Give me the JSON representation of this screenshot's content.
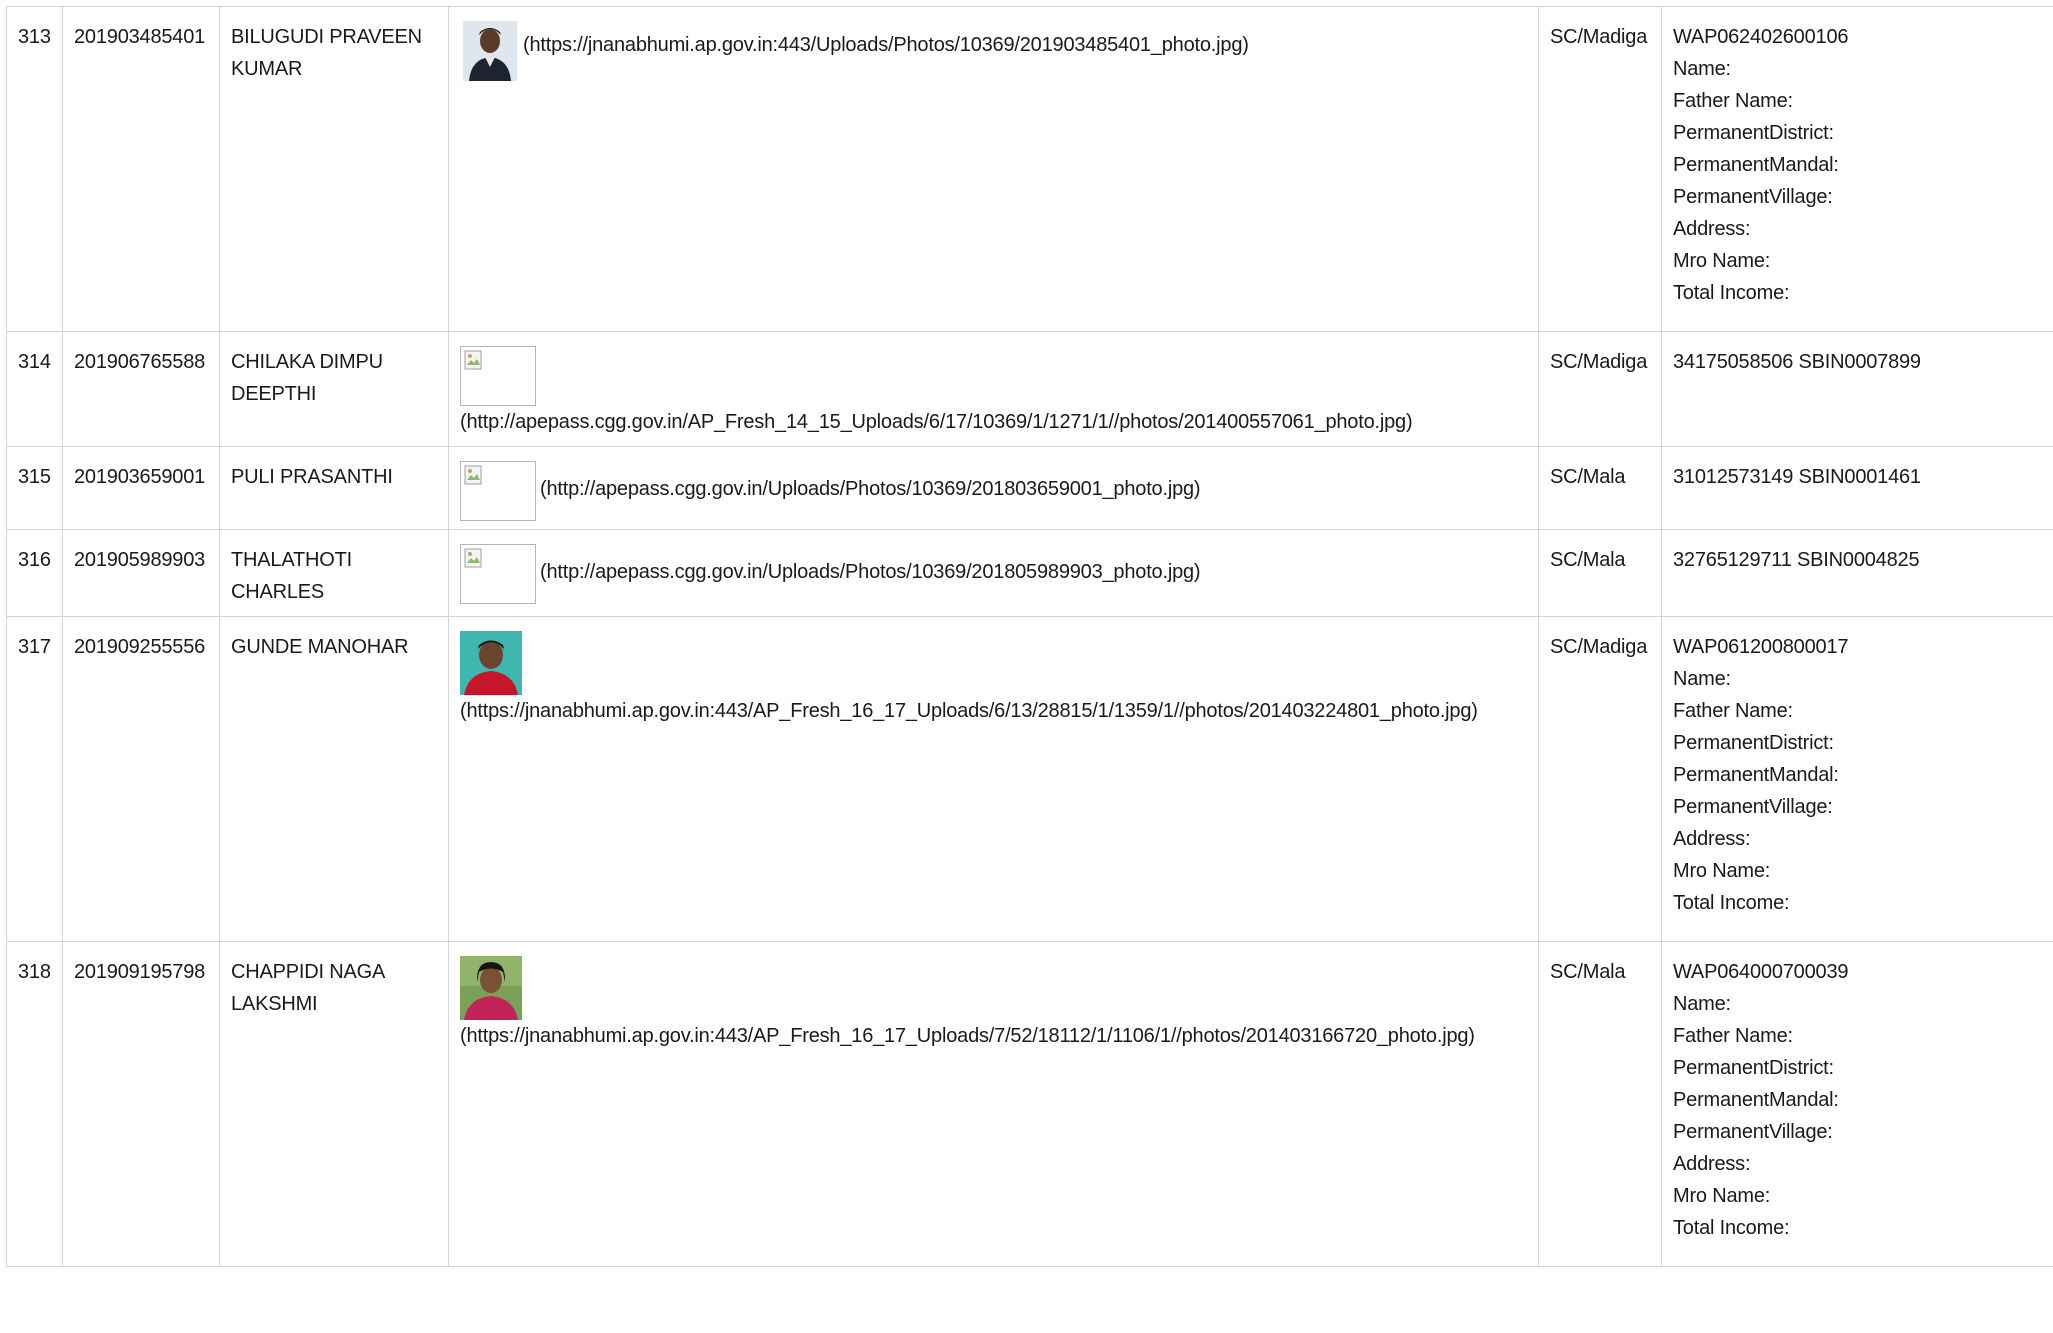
{
  "rows": [
    {
      "sno": "313",
      "id": "201903485401",
      "name": "BILUGUDI PRAVEEN KUMAR",
      "photo_kind": "photo-blue",
      "photo_url": "(https://jnanabhumi.ap.gov.in:443/Uploads/Photos/10369/201903485401_photo.jpg)",
      "category": "SC/Madiga",
      "bank": "WAP062402600106",
      "details": [
        "Name:",
        "Father Name:",
        "PermanentDistrict:",
        "PermanentMandal:",
        "PermanentVillage:",
        "Address:",
        "Mro Name:",
        "Total Income:"
      ]
    },
    {
      "sno": "314",
      "id": "201906765588",
      "name": "CHILAKA DIMPU DEEPTHI",
      "photo_kind": "broken",
      "photo_url": "(http://apepass.cgg.gov.in/AP_Fresh_14_15_Uploads/6/17/10369/1/1271/1//photos/201400557061_photo.jpg)",
      "category": "SC/Madiga",
      "bank": "34175058506 SBIN0007899",
      "details": []
    },
    {
      "sno": "315",
      "id": "201903659001",
      "name": "PULI PRASANTHI",
      "photo_kind": "broken",
      "photo_url": "(http://apepass.cgg.gov.in/Uploads/Photos/10369/201803659001_photo.jpg)",
      "category": "SC/Mala",
      "bank": "31012573149 SBIN0001461",
      "details": []
    },
    {
      "sno": "316",
      "id": "201905989903",
      "name": "THALATHOTI CHARLES",
      "photo_kind": "broken",
      "photo_url": "(http://apepass.cgg.gov.in/Uploads/Photos/10369/201805989903_photo.jpg)",
      "category": "SC/Mala",
      "bank": "32765129711 SBIN0004825",
      "details": []
    },
    {
      "sno": "317",
      "id": "201909255556",
      "name": "GUNDE MANOHAR",
      "photo_kind": "photo-teal",
      "photo_url": "(https://jnanabhumi.ap.gov.in:443/AP_Fresh_16_17_Uploads/6/13/28815/1/1359/1//photos/201403224801_photo.jpg)",
      "category": "SC/Madiga",
      "bank": "WAP061200800017",
      "details": [
        "Name:",
        "Father Name:",
        "PermanentDistrict:",
        "PermanentMandal:",
        "PermanentVillage:",
        "Address:",
        "Mro Name:",
        "Total Income:"
      ]
    },
    {
      "sno": "318",
      "id": "201909195798",
      "name": "CHAPPIDI NAGA LAKSHMI",
      "photo_kind": "photo-green",
      "photo_url": "(https://jnanabhumi.ap.gov.in:443/AP_Fresh_16_17_Uploads/7/52/18112/1/1106/1//photos/201403166720_photo.jpg)",
      "category": "SC/Mala",
      "bank": "WAP064000700039",
      "details": [
        "Name:",
        "Father Name:",
        "PermanentDistrict:",
        "PermanentMandal:",
        "PermanentVillage:",
        "Address:",
        "Mro Name:",
        "Total Income:"
      ]
    }
  ],
  "colors": {
    "border": "#d4d4d4",
    "text": "#1a1a1a"
  }
}
